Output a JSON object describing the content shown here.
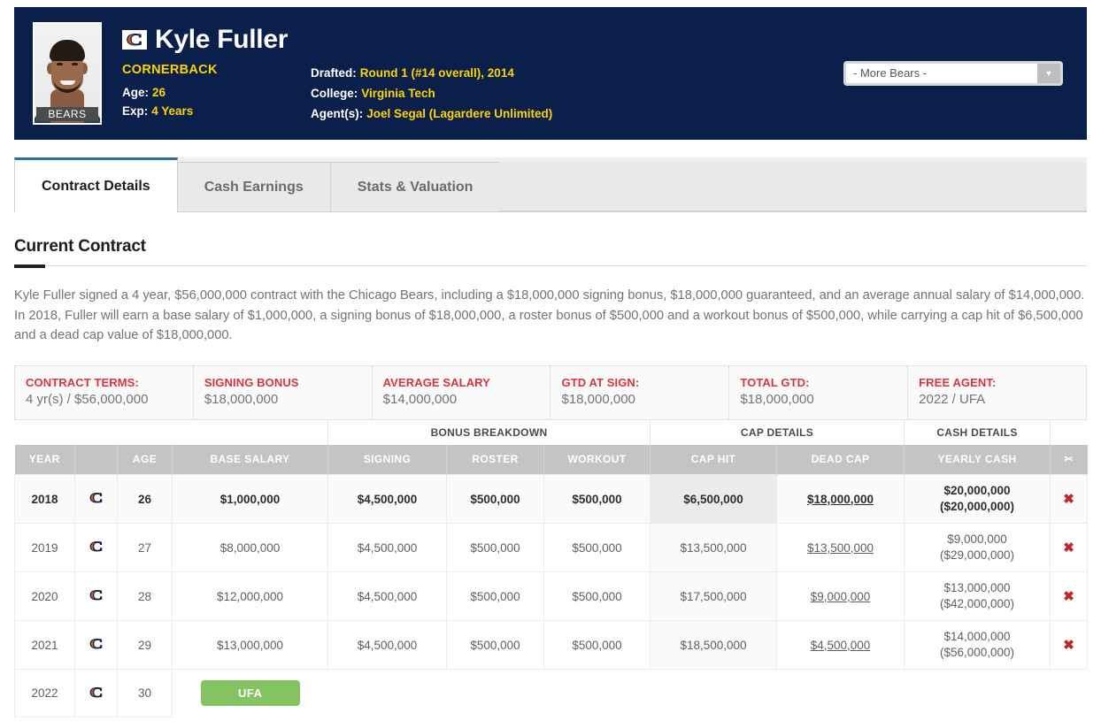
{
  "header": {
    "player_name": "Kyle Fuller",
    "team_logo_letter": "C",
    "photo_caption": "BEARS",
    "position": "CORNERBACK",
    "age_label": "Age:",
    "age_value": "26",
    "exp_label": "Exp:",
    "exp_value": "4 Years",
    "drafted_label": "Drafted:",
    "drafted_value": "Round 1 (#14 overall), 2014",
    "college_label": "College:",
    "college_value": "Virginia Tech",
    "agents_label": "Agent(s):",
    "agents_value": "Joel Segal (Lagardere Unlimited)",
    "more_select_value": "- More Bears -",
    "navy": "#0b1f4b",
    "gold": "#ffd400"
  },
  "tabs": [
    {
      "label": "Contract Details",
      "active": true
    },
    {
      "label": "Cash Earnings",
      "active": false
    },
    {
      "label": "Stats & Valuation",
      "active": false
    }
  ],
  "section": {
    "title": "Current Contract",
    "blurb": "Kyle Fuller signed a 4 year, $56,000,000 contract with the Chicago Bears, including a $18,000,000 signing bonus, $18,000,000 guaranteed, and an average annual salary of $14,000,000. In 2018, Fuller will earn a base salary of $1,000,000, a signing bonus of $18,000,000, a roster bonus of $500,000 and a workout bonus of $500,000, while carrying a cap hit of $6,500,000 and a dead cap value of $18,000,000."
  },
  "summary": [
    {
      "label": "CONTRACT TERMS:",
      "value": "4 yr(s) / $56,000,000"
    },
    {
      "label": "SIGNING BONUS",
      "value": "$18,000,000"
    },
    {
      "label": "AVERAGE SALARY",
      "value": "$14,000,000"
    },
    {
      "label": "GTD AT SIGN:",
      "value": "$18,000,000"
    },
    {
      "label": "TOTAL GTD:",
      "value": "$18,000,000"
    },
    {
      "label": "FREE AGENT:",
      "value": "2022 / UFA"
    }
  ],
  "table": {
    "group_headers": [
      {
        "label": "",
        "span": 4
      },
      {
        "label": "BONUS BREAKDOWN",
        "span": 3
      },
      {
        "label": "CAP DETAILS",
        "span": 2
      },
      {
        "label": "CASH DETAILS",
        "span": 1
      },
      {
        "label": "",
        "span": 1
      }
    ],
    "columns": [
      "YEAR",
      "",
      "AGE",
      "BASE SALARY",
      "SIGNING",
      "ROSTER",
      "WORKOUT",
      "CAP HIT",
      "DEAD CAP",
      "YEARLY CASH",
      "✂"
    ],
    "cut_icon": "✖",
    "rows": [
      {
        "year": "2018",
        "age": "26",
        "current": true,
        "base_salary": "$1,000,000",
        "signing": "$4,500,000",
        "roster": "$500,000",
        "workout": "$500,000",
        "cap_hit": "$6,500,000",
        "dead_cap": "$18,000,000",
        "yearly_cash": "$20,000,000",
        "cumulative_cash": "($20,000,000)"
      },
      {
        "year": "2019",
        "age": "27",
        "current": false,
        "base_salary": "$8,000,000",
        "signing": "$4,500,000",
        "roster": "$500,000",
        "workout": "$500,000",
        "cap_hit": "$13,500,000",
        "dead_cap": "$13,500,000",
        "yearly_cash": "$9,000,000",
        "cumulative_cash": "($29,000,000)"
      },
      {
        "year": "2020",
        "age": "28",
        "current": false,
        "base_salary": "$12,000,000",
        "signing": "$4,500,000",
        "roster": "$500,000",
        "workout": "$500,000",
        "cap_hit": "$17,500,000",
        "dead_cap": "$9,000,000",
        "yearly_cash": "$13,000,000",
        "cumulative_cash": "($42,000,000)"
      },
      {
        "year": "2021",
        "age": "29",
        "current": false,
        "base_salary": "$13,000,000",
        "signing": "$4,500,000",
        "roster": "$500,000",
        "workout": "$500,000",
        "cap_hit": "$18,500,000",
        "dead_cap": "$4,500,000",
        "yearly_cash": "$14,000,000",
        "cumulative_cash": "($56,000,000)"
      }
    ],
    "final_row": {
      "year": "2022",
      "age": "30",
      "badge": "UFA",
      "badge_color": "#83c361"
    }
  }
}
